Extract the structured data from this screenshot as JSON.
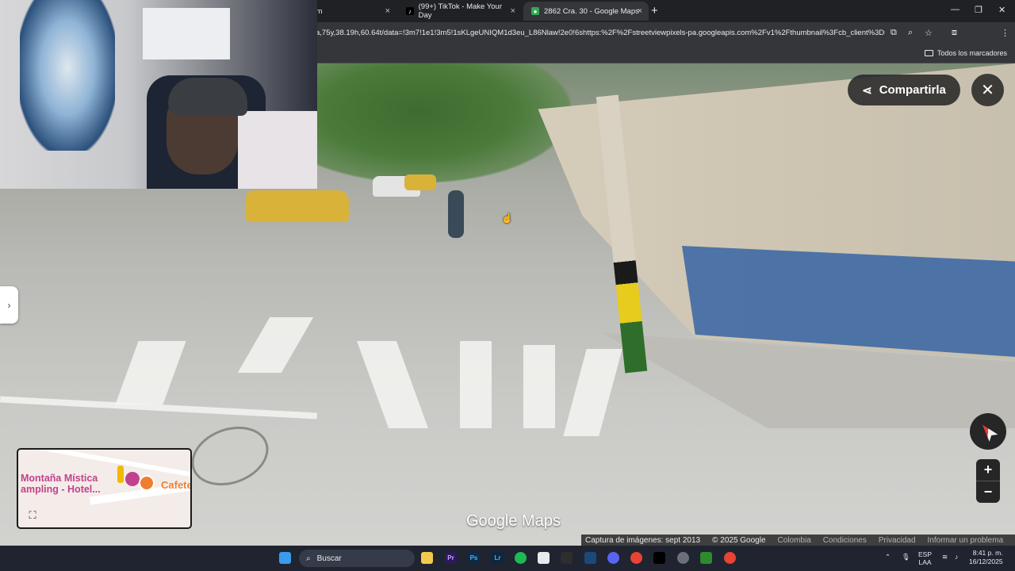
{
  "browser": {
    "tabs": [
      {
        "label": "ram",
        "active": false
      },
      {
        "label": "(99+) TikTok - Make Your Day",
        "active": false
      },
      {
        "label": "2862 Cra. 30 - Google Maps",
        "active": true
      }
    ],
    "url": "a,75y,38.19h,60.64t/data=!3m7!1e1!3m5!1sKLgeUNIQM1d3eu_L86Nlaw!2e0!6shttps:%2F%2Fstreetviewpixels-pa.googleapis.com%2Fv1%2Fthumbnail%3Fcb_client%3Dmaps_...",
    "bookmarks_label": "Todos los marcadores",
    "new_tab": "+",
    "close_glyph": "×"
  },
  "streetview": {
    "share_label": "Compartirla",
    "close_glyph": "✕",
    "side_toggle_glyph": "›",
    "zoom_in": "+",
    "zoom_out": "−",
    "logo": "Google Maps"
  },
  "minimap": {
    "place1_line1": "Montaña Mística",
    "place1_line2": "ampling - Hotel...",
    "place2": "Cafete",
    "expand_glyph": "⛶"
  },
  "attribution": {
    "capture": "Captura de imágenes: sept 2013",
    "copyright": "© 2025 Google",
    "country": "Colombia",
    "terms": "Condiciones",
    "privacy": "Privacidad",
    "report": "Informar un problema"
  },
  "taskbar": {
    "search_placeholder": "Buscar",
    "lang_line1": "ESP",
    "lang_line2": "LAA",
    "time": "8:41 p. m.",
    "date": "16/12/2025"
  }
}
